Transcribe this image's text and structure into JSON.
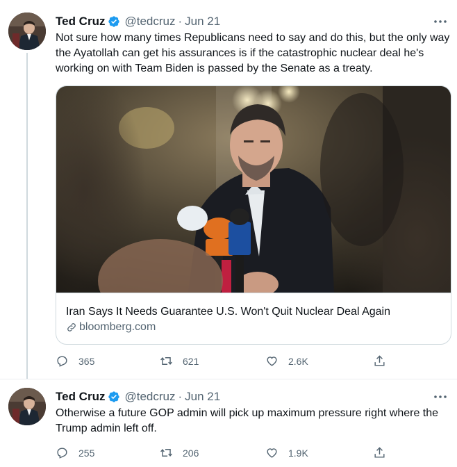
{
  "tweets": [
    {
      "author_name": "Ted Cruz",
      "handle": "@tedcruz",
      "separator": "·",
      "date": "Jun 21",
      "text": "Not sure how many times Republicans need to say and do this, but the only way the Ayatollah can get his assurances is if the catastrophic nuclear deal he's working on with Team Biden is passed by the Senate as a treaty.",
      "card": {
        "title": "Iran Says It Needs Guarantee U.S. Won't Quit Nuclear Deal Again",
        "domain": "bloomberg.com"
      },
      "replies": "365",
      "retweets": "621",
      "likes": "2.6K"
    },
    {
      "author_name": "Ted Cruz",
      "handle": "@tedcruz",
      "separator": "·",
      "date": "Jun 21",
      "text": "Otherwise a future GOP admin will pick up maximum pressure right where the Trump admin left off.",
      "replies": "255",
      "retweets": "206",
      "likes": "1.9K"
    }
  ],
  "colors": {
    "text": "#0f1419",
    "secondary": "#536471",
    "verified": "#1d9bf0",
    "border": "#cfd9de"
  },
  "icons": [
    "avatar",
    "verified-badge-icon",
    "more-options-icon",
    "reply-icon",
    "retweet-icon",
    "like-icon",
    "share-icon",
    "link-icon"
  ]
}
